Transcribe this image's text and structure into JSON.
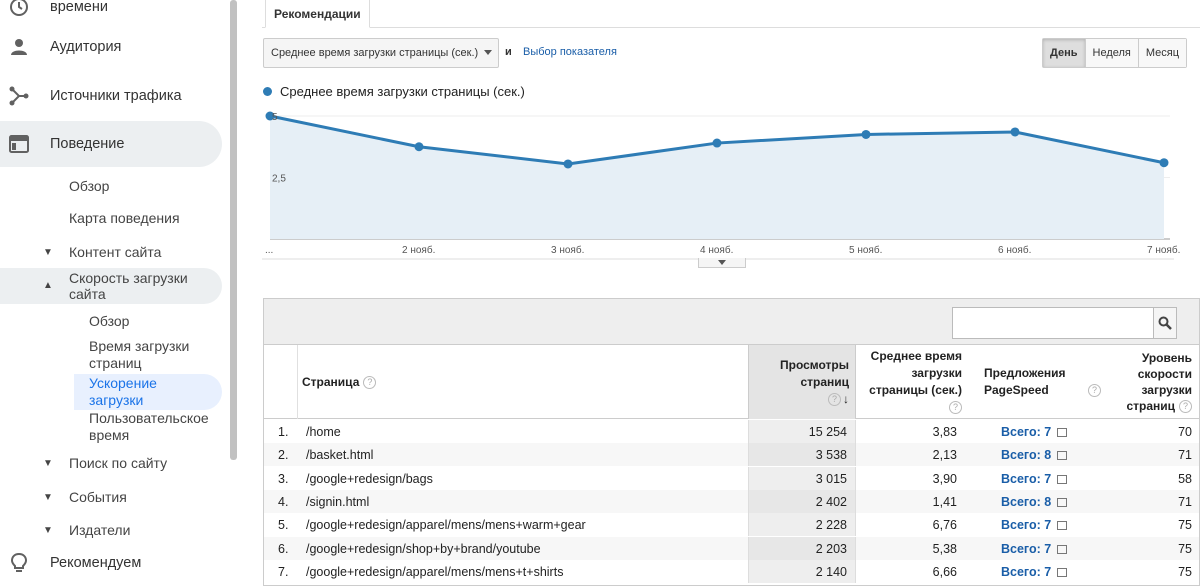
{
  "sidebar": {
    "top_partial": "времени",
    "items": [
      {
        "label": "Аудитория",
        "icon": "person-icon"
      },
      {
        "label": "Источники трафика",
        "icon": "acquisition-icon"
      },
      {
        "label": "Поведение",
        "icon": "behavior-icon"
      },
      {
        "label": "Рекомендуем",
        "icon": "lightbulb-icon"
      }
    ],
    "behavior": {
      "overview": "Обзор",
      "behavior_map": "Карта поведения",
      "content": "Контент сайта",
      "speed": "Скорость загрузки сайта",
      "speed_children": {
        "overview": "Обзор",
        "page_timings": "Время загрузки страниц",
        "speed_suggestions": "Ускорение загрузки",
        "user_timings": "Пользовательское время"
      },
      "site_search": "Поиск по сайту",
      "events": "События",
      "publishers": "Издатели"
    }
  },
  "tabs": {
    "recommendations": "Рекомендации"
  },
  "controls": {
    "metric_select": "Среднее время загрузки страницы (сек.)",
    "and": "и",
    "pick_metric": "Выбор показателя",
    "periods": [
      "День",
      "Неделя",
      "Месяц"
    ],
    "active_period": "День"
  },
  "chart_data": {
    "type": "area",
    "legend": "Среднее время загрузки страницы (сек.)",
    "series_color": "#2e7cb5",
    "x_labels": [
      "...",
      "2 нояб.",
      "3 нояб.",
      "4 нояб.",
      "5 нояб.",
      "6 нояб.",
      "7 нояб."
    ],
    "values": [
      5.0,
      3.75,
      3.05,
      3.9,
      4.25,
      4.35,
      3.1
    ],
    "y_ticks": [
      "5",
      "2,5"
    ],
    "ylim": [
      0,
      5
    ]
  },
  "table": {
    "search_placeholder": "",
    "headers": {
      "page": "Страница",
      "views": "Просмотры страниц",
      "avg_time": "Среднее время загрузки страницы (сек.)",
      "pagespeed": "Предложения PageSpeed",
      "speed_score": "Уровень скорости загрузки страниц"
    },
    "rows": [
      {
        "idx": "1.",
        "page": "/home",
        "views": "15 254",
        "time": "3,83",
        "ps": "Всего: 7",
        "score": "70"
      },
      {
        "idx": "2.",
        "page": "/basket.html",
        "views": "3 538",
        "time": "2,13",
        "ps": "Всего: 8",
        "score": "71"
      },
      {
        "idx": "3.",
        "page": "/google+redesign/bags",
        "views": "3 015",
        "time": "3,90",
        "ps": "Всего: 7",
        "score": "58"
      },
      {
        "idx": "4.",
        "page": "/signin.html",
        "views": "2 402",
        "time": "1,41",
        "ps": "Всего: 8",
        "score": "71"
      },
      {
        "idx": "5.",
        "page": "/google+redesign/apparel/mens/mens+warm+gear",
        "views": "2 228",
        "time": "6,76",
        "ps": "Всего: 7",
        "score": "75"
      },
      {
        "idx": "6.",
        "page": "/google+redesign/shop+by+brand/youtube",
        "views": "2 203",
        "time": "5,38",
        "ps": "Всего: 7",
        "score": "75"
      },
      {
        "idx": "7.",
        "page": "/google+redesign/apparel/mens/mens+t+shirts",
        "views": "2 140",
        "time": "6,66",
        "ps": "Всего: 7",
        "score": "75"
      }
    ]
  }
}
